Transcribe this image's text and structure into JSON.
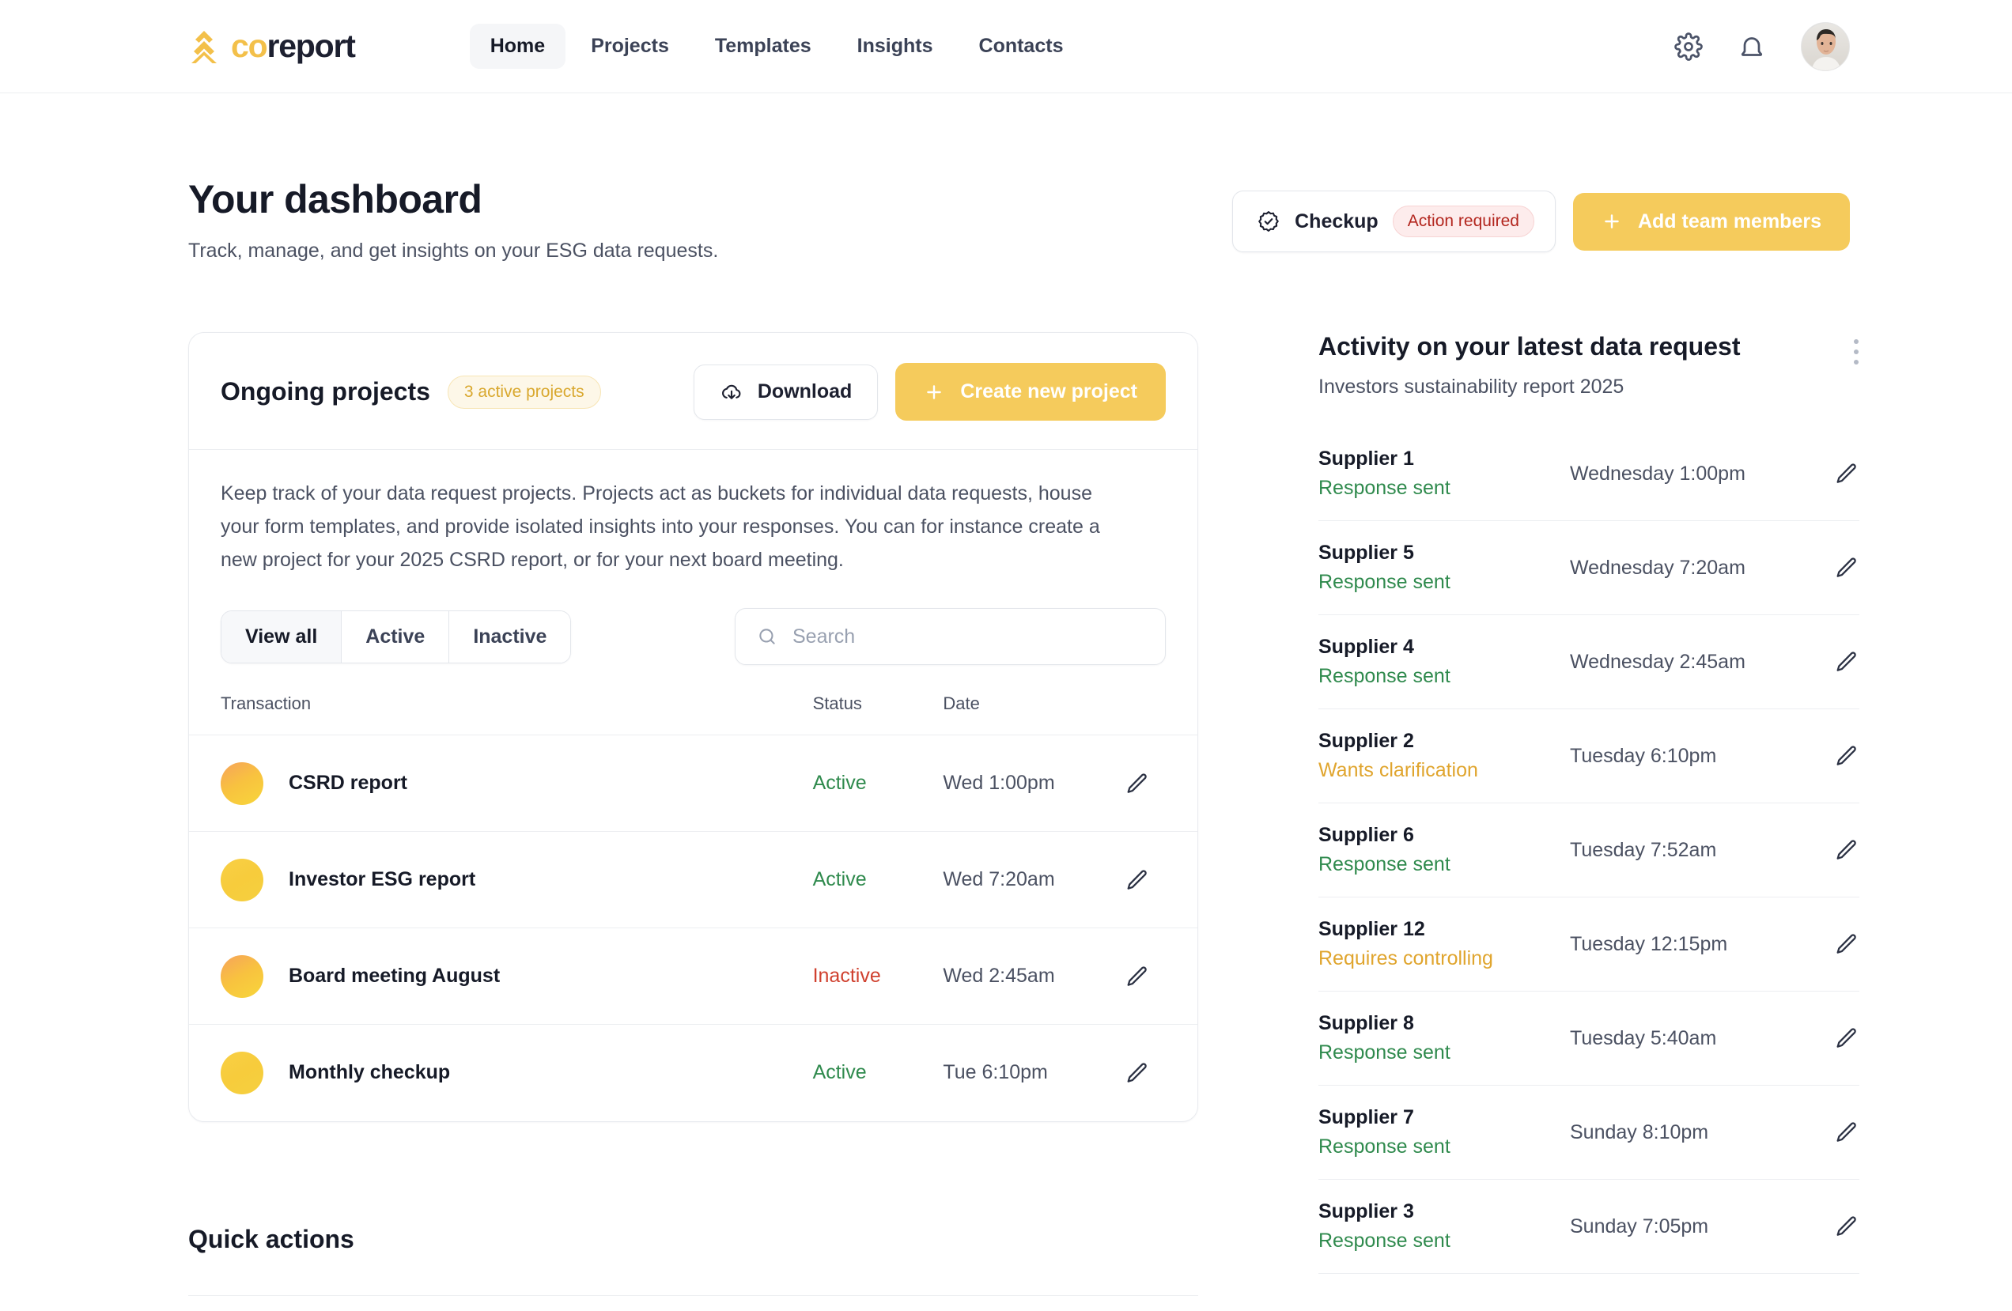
{
  "brand": {
    "co": "co",
    "report": "report",
    "logo_icon": "chevron-stack-logo"
  },
  "nav": {
    "items": [
      {
        "label": "Home",
        "active": true
      },
      {
        "label": "Projects",
        "active": false
      },
      {
        "label": "Templates",
        "active": false
      },
      {
        "label": "Insights",
        "active": false
      },
      {
        "label": "Contacts",
        "active": false
      }
    ],
    "gear_icon": "gear-icon",
    "bell_icon": "bell-icon",
    "avatar_icon": "user-avatar"
  },
  "header": {
    "title": "Your dashboard",
    "subtitle": "Track, manage, and get insights on your ESG data requests.",
    "checkup_label": "Checkup",
    "checkup_badge": "Action required",
    "checkup_icon": "badge-check-icon",
    "add_members_label": "Add team members",
    "add_members_icon": "plus-icon"
  },
  "projects": {
    "title": "Ongoing projects",
    "count_badge": "3 active projects",
    "download_label": "Download",
    "download_icon": "cloud-download-icon",
    "create_label": "Create new project",
    "create_icon": "plus-icon",
    "description": "Keep track of your data request projects. Projects act as buckets for individual data requests, house your form templates, and provide isolated insights into your responses. You can for instance create a new project for your 2025 CSRD report, or for your next board meeting.",
    "filters": [
      {
        "label": "View all",
        "active": true
      },
      {
        "label": "Active",
        "active": false
      },
      {
        "label": "Inactive",
        "active": false
      }
    ],
    "search_placeholder": "Search",
    "search_value": "",
    "search_icon": "search-icon",
    "columns": {
      "name": "Transaction",
      "status": "Status",
      "date": "Date"
    },
    "rows": [
      {
        "name": "CSRD report",
        "status": "Active",
        "status_kind": "active",
        "date": "Wed 1:00pm",
        "avatar": "g1",
        "edit_icon": "pencil-icon"
      },
      {
        "name": "Investor ESG report",
        "status": "Active",
        "status_kind": "active",
        "date": "Wed 7:20am",
        "avatar": "g2",
        "edit_icon": "pencil-icon"
      },
      {
        "name": "Board meeting August",
        "status": "Inactive",
        "status_kind": "inactive",
        "date": "Wed 2:45am",
        "avatar": "g1",
        "edit_icon": "pencil-icon"
      },
      {
        "name": "Monthly checkup",
        "status": "Active",
        "status_kind": "active",
        "date": "Tue 6:10pm",
        "avatar": "g2",
        "edit_icon": "pencil-icon"
      }
    ]
  },
  "quick_actions": {
    "title": "Quick actions"
  },
  "activity": {
    "title": "Activity on your latest data request",
    "subtitle": "Investors sustainability report 2025",
    "menu_icon": "kebab-menu-icon",
    "rows": [
      {
        "supplier": "Supplier 1",
        "state": "Response sent",
        "state_kind": "green",
        "time": "Wednesday 1:00pm",
        "edit_icon": "pencil-icon"
      },
      {
        "supplier": "Supplier 5",
        "state": "Response sent",
        "state_kind": "green",
        "time": "Wednesday 7:20am",
        "edit_icon": "pencil-icon"
      },
      {
        "supplier": "Supplier 4",
        "state": "Response sent",
        "state_kind": "green",
        "time": "Wednesday 2:45am",
        "edit_icon": "pencil-icon"
      },
      {
        "supplier": "Supplier 2",
        "state": "Wants clarification",
        "state_kind": "amber",
        "time": "Tuesday 6:10pm",
        "edit_icon": "pencil-icon"
      },
      {
        "supplier": "Supplier 6",
        "state": "Response sent",
        "state_kind": "green",
        "time": "Tuesday 7:52am",
        "edit_icon": "pencil-icon"
      },
      {
        "supplier": "Supplier 12",
        "state": "Requires controlling",
        "state_kind": "amber",
        "time": "Tuesday 12:15pm",
        "edit_icon": "pencil-icon"
      },
      {
        "supplier": "Supplier 8",
        "state": "Response sent",
        "state_kind": "green",
        "time": "Tuesday 5:40am",
        "edit_icon": "pencil-icon"
      },
      {
        "supplier": "Supplier 7",
        "state": "Response sent",
        "state_kind": "green",
        "time": "Sunday 8:10pm",
        "edit_icon": "pencil-icon"
      },
      {
        "supplier": "Supplier 3",
        "state": "Response sent",
        "state_kind": "green",
        "time": "Sunday 7:05pm",
        "edit_icon": "pencil-icon"
      }
    ]
  },
  "colors": {
    "brand_yellow": "#f5cb5c",
    "text_dark": "#161a27",
    "text_muted": "#4b5162",
    "green": "#2f8a4d",
    "red": "#d0412f",
    "amber": "#e0a52e",
    "danger_badge": "#b3261e"
  }
}
